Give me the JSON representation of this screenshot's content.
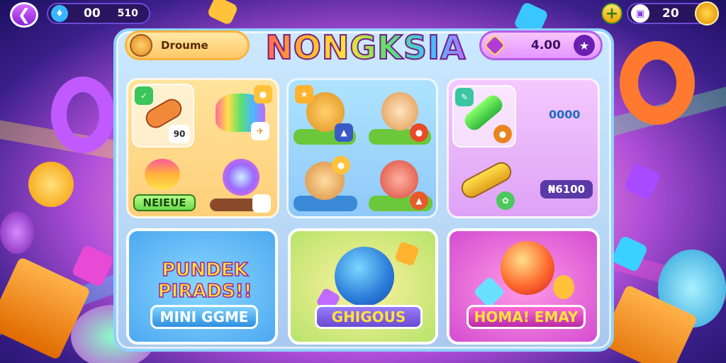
{
  "hud": {
    "gems_a": "00",
    "gems_b": "510",
    "tickets": "20"
  },
  "player": {
    "name": "Droume"
  },
  "game_title": "NONGKSIA",
  "score": {
    "value": "4.00"
  },
  "shop": {
    "section_a": {
      "label": "NEIEUE",
      "badge_1": "90",
      "badge_2": ""
    },
    "section_c": {
      "price_1": "0000",
      "price_2": "₦6100"
    }
  },
  "mini_games": [
    {
      "title": "PUNDEK PIRADS!!",
      "button": "MINI GGME"
    },
    {
      "title": "",
      "button": "GHIGOUS"
    },
    {
      "title": "",
      "button": "HOMA! EMAY"
    }
  ],
  "colors": {
    "accent_purple": "#8a1fd6",
    "accent_gold": "#ffc766",
    "accent_blue": "#4da8f0"
  },
  "icons": [
    "back-arrow-icon",
    "gem-icon",
    "plus-icon",
    "ticket-icon",
    "coin-icon",
    "star-icon"
  ]
}
